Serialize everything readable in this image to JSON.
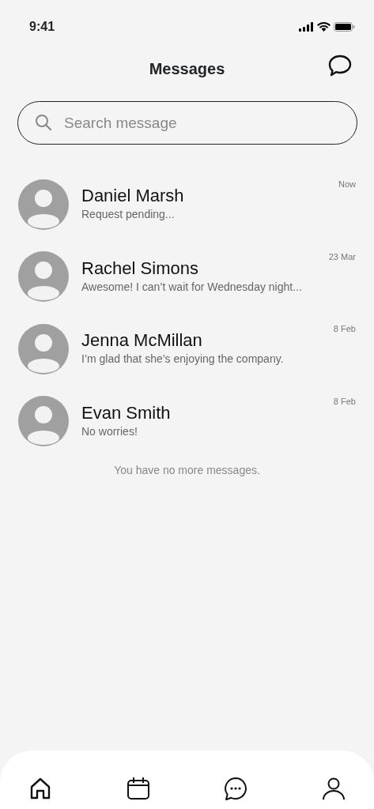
{
  "status_bar": {
    "time": "9:41"
  },
  "header": {
    "title": "Messages"
  },
  "search": {
    "placeholder": "Search message"
  },
  "conversations": [
    {
      "name": "Daniel Marsh",
      "preview": "Request pending...",
      "time": "Now"
    },
    {
      "name": "Rachel Simons",
      "preview": "Awesome! I can’t wait for Wednesday night...",
      "time": "23 Mar"
    },
    {
      "name": "Jenna McMillan",
      "preview": "I’m glad that she’s enjoying the company.",
      "time": "8 Feb"
    },
    {
      "name": "Evan Smith",
      "preview": "No worries!",
      "time": "8 Feb"
    }
  ],
  "footer_note": "You have no more messages.",
  "tab_bar": [
    {
      "kind": "home"
    },
    {
      "kind": "calendar"
    },
    {
      "kind": "chat"
    },
    {
      "kind": "profile"
    }
  ]
}
